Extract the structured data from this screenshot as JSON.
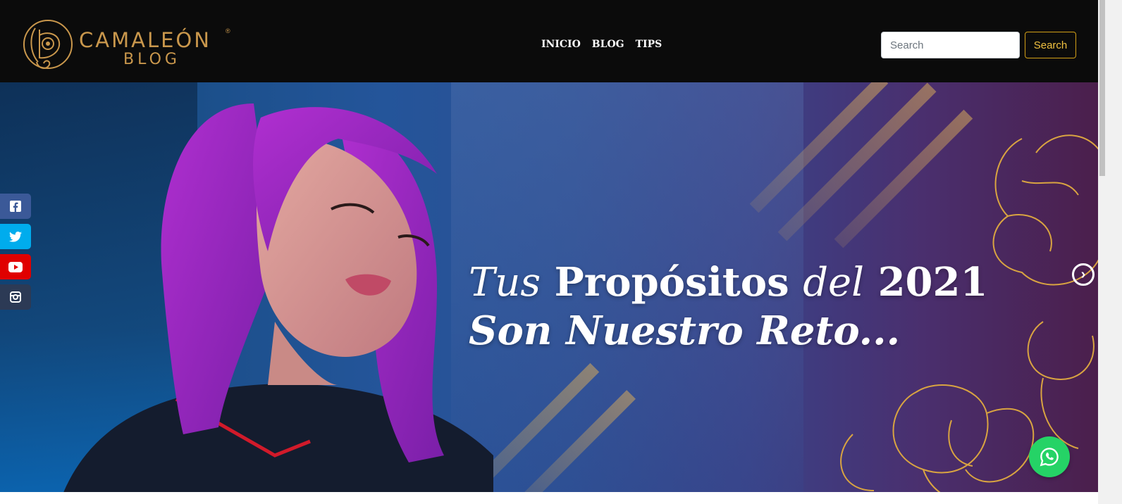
{
  "brand": {
    "name": "CAMALEÓN",
    "sub": "BLOG",
    "reg": "®",
    "color": "#c9974c"
  },
  "nav": {
    "items": [
      "INICIO",
      "BLOG",
      "TIPS"
    ]
  },
  "search": {
    "placeholder": "Search",
    "button_label": "Search"
  },
  "hero": {
    "title_line1": {
      "w1": "Tus",
      "w2": "Propósitos",
      "w3": "del",
      "w4": "2021"
    },
    "title_line2": "Son Nuestro Reto...",
    "next_icon": "chevron-right-circle-icon"
  },
  "social": [
    {
      "name": "facebook",
      "color": "#3b5998"
    },
    {
      "name": "twitter",
      "color": "#00aced"
    },
    {
      "name": "youtube",
      "color": "#e00000"
    },
    {
      "name": "instagram",
      "color": "#2c3a55"
    }
  ],
  "whatsapp": {
    "icon": "whatsapp-icon",
    "color": "#25d366"
  }
}
